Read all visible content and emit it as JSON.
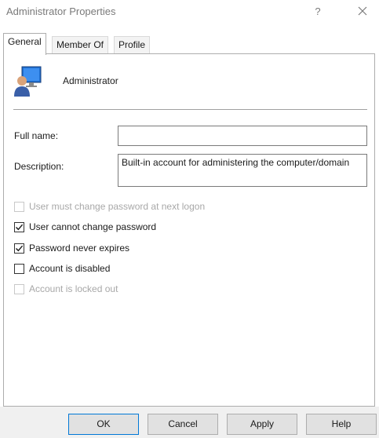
{
  "window": {
    "title": "Administrator Properties",
    "help_label": "?"
  },
  "tabs": [
    {
      "label": "General",
      "active": true
    },
    {
      "label": "Member Of",
      "active": false
    },
    {
      "label": "Profile",
      "active": false
    }
  ],
  "general": {
    "user_name": "Administrator",
    "user_icon": "user-account-icon",
    "full_name_label": "Full name:",
    "full_name_value": "",
    "description_label": "Description:",
    "description_value": "Built-in account for administering the computer/domain"
  },
  "options": [
    {
      "label": "User must change password at next logon",
      "checked": false,
      "enabled": false
    },
    {
      "label": "User cannot change password",
      "checked": true,
      "enabled": true
    },
    {
      "label": "Password never expires",
      "checked": true,
      "enabled": true
    },
    {
      "label": "Account is disabled",
      "checked": false,
      "enabled": true
    },
    {
      "label": "Account is locked out",
      "checked": false,
      "enabled": false
    }
  ],
  "buttons": {
    "ok": "OK",
    "cancel": "Cancel",
    "apply": "Apply",
    "help": "Help"
  },
  "colors": {
    "accent": "#0078d7",
    "disabled_text": "#a8a8a8"
  }
}
